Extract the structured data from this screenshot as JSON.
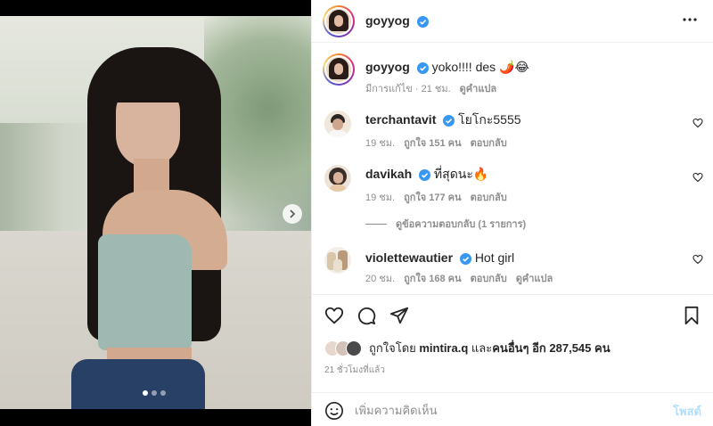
{
  "post": {
    "author": "goyyog",
    "caption_text": "yoko!!!! des 🌶️😂",
    "caption_edited": "มีการแก้ไข · 21 ชม.",
    "caption_translate": "ดูคำแปล",
    "media_dots": 3,
    "media_active_dot": 1
  },
  "comments": [
    {
      "user": "terchantavit",
      "verified": true,
      "text": "โยโกะ5555",
      "time": "19 ชม.",
      "likes": "ถูกใจ 151 คน",
      "reply": "ตอบกลับ"
    },
    {
      "user": "davikah",
      "verified": true,
      "text": "ที่สุดนะ🔥",
      "time": "19 ชม.",
      "likes": "ถูกใจ 177 คน",
      "reply": "ตอบกลับ"
    },
    {
      "user": "violettewautier",
      "verified": true,
      "text": "Hot girl",
      "time": "20 ชม.",
      "likes": "ถูกใจ 168 คน",
      "reply": "ตอบกลับ",
      "translate": "ดูคำแปล"
    }
  ],
  "view_replies": "ดูข้อความตอบกลับ (1 รายการ)",
  "likes": {
    "prefix": "ถูกใจโดย",
    "user": "mintira.q",
    "middle": "และ",
    "others": "คนอื่นๆ อีก 287,545 คน"
  },
  "posted_ago": "21 ชั่วโมงที่แล้ว",
  "add_comment": {
    "placeholder": "เพิ่มความคิดเห็น",
    "post_label": "โพสต์"
  },
  "colors": {
    "verified": "#3897f0",
    "post_disabled": "#b2dffc",
    "meta_gray": "#8e8e8e"
  },
  "icons": [
    "more-icon",
    "heart-icon",
    "comment-icon",
    "share-icon",
    "bookmark-icon",
    "emoji-icon",
    "next-arrow-icon",
    "verified-icon"
  ]
}
